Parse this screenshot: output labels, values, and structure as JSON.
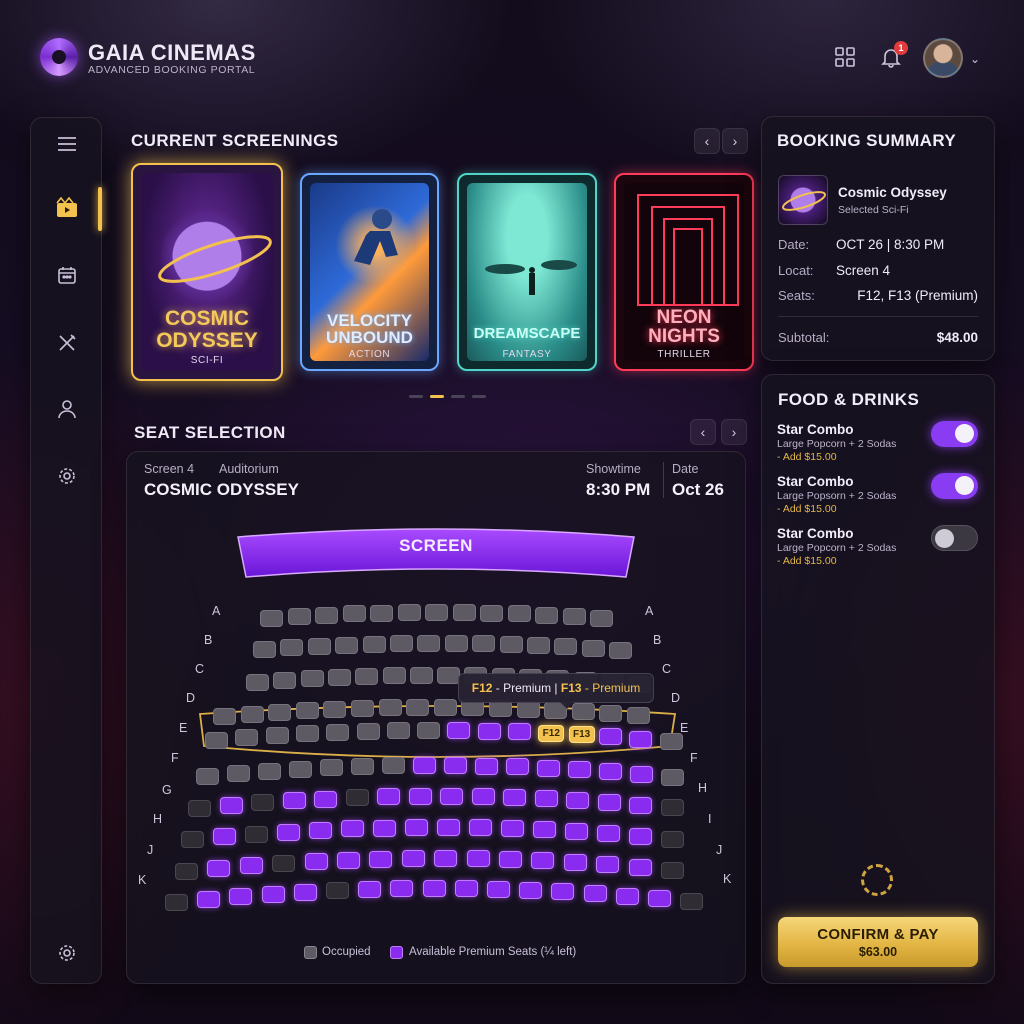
{
  "brand": {
    "title": "GAIA CINEMAS",
    "subtitle": "ADVANCED BOOKING PORTAL"
  },
  "header": {
    "grid_icon": "grid-icon",
    "bell_icon": "bell-icon",
    "notification_count": "1",
    "avatar": "user-avatar",
    "chevron": "⌄"
  },
  "sidebar": {
    "items": [
      "menu-icon",
      "film-icon",
      "calendar-icon",
      "dining-icon",
      "user-icon",
      "settings-icon"
    ],
    "bottom": "settings-icon",
    "active": "film-icon"
  },
  "screenings": {
    "title": "CURRENT SCREENINGS",
    "prev": "‹",
    "next": "›",
    "cards": [
      {
        "title_line1": "COSMIC",
        "title_line2": "ODYSSEY",
        "genre": "SCI-FI",
        "accent": "#f2c14e"
      },
      {
        "title_line1": "VELOCITY",
        "title_line2": "UNBOUND",
        "genre": "ACTION",
        "accent": "#6aa8ff"
      },
      {
        "title_line1": "DREAMSCAPE",
        "title_line2": "",
        "genre": "FANTASY",
        "accent": "#4fd6c8"
      },
      {
        "title_line1": "NEON",
        "title_line2": "NIGHTS",
        "genre": "THRILLER",
        "accent": "#ff3a5a"
      }
    ]
  },
  "seat_selection": {
    "title": "SEAT SELECTION",
    "prev": "‹",
    "next": "›",
    "screen_label": "Screen 4",
    "auditorium_label": "Auditorium",
    "movie": "COSMIC ODYSSEY",
    "showtime_label": "Showtime",
    "showtime": "8:30 PM",
    "date_label": "Date",
    "date": "Oct 26",
    "screen_text": "SCREEN",
    "rows": [
      "A",
      "B",
      "C",
      "D",
      "E",
      "F",
      "G",
      "H",
      "J",
      "K"
    ],
    "right_rows": [
      "A",
      "B",
      "C",
      "D",
      "E",
      "F",
      "H",
      "I",
      "J",
      "K"
    ],
    "selected_seats": [
      "F12",
      "F13"
    ],
    "tooltip": {
      "seat1": "F12",
      "label1": " - Premium",
      "sep": " | ",
      "seat2": "F13",
      "label2": " - Premium"
    },
    "legend": {
      "occupied": "Occupied",
      "available": "Available Premium Seats (¼ left)"
    }
  },
  "summary": {
    "title": "BOOKING SUMMARY",
    "movie": "Cosmic Odyssey",
    "sub": "Selected Sci-Fi",
    "date_label": "Date:",
    "date_value": "OCT 26 | 8:30 PM",
    "loc_label": "Locat:",
    "loc_value": "Screen 4",
    "seats_label": "Seats:",
    "seats_value": "F12, F13 (Premium)",
    "subtotal_label": "Subtotal:",
    "subtotal_value": "$48.00"
  },
  "food": {
    "title": "FOOD & DRINKS",
    "items": [
      {
        "name": "Star Combo",
        "desc": "Large Popcorn + 2 Sodas",
        "price": "- Add $15.00",
        "on": true
      },
      {
        "name": "Star Combo",
        "desc": "Large Popsorn + 2 Sodas",
        "price": "- Add $15.00",
        "on": true
      },
      {
        "name": "Star Combo",
        "desc": "Large Popcorn + 2 Sodas",
        "price": "- Add $15.00",
        "on": false
      }
    ]
  },
  "confirm": {
    "label": "CONFIRM & PAY",
    "amount": "$63.00"
  },
  "colors": {
    "gold": "#f2c14e",
    "purple": "#8a2cf0",
    "bg": "#140d1e"
  }
}
